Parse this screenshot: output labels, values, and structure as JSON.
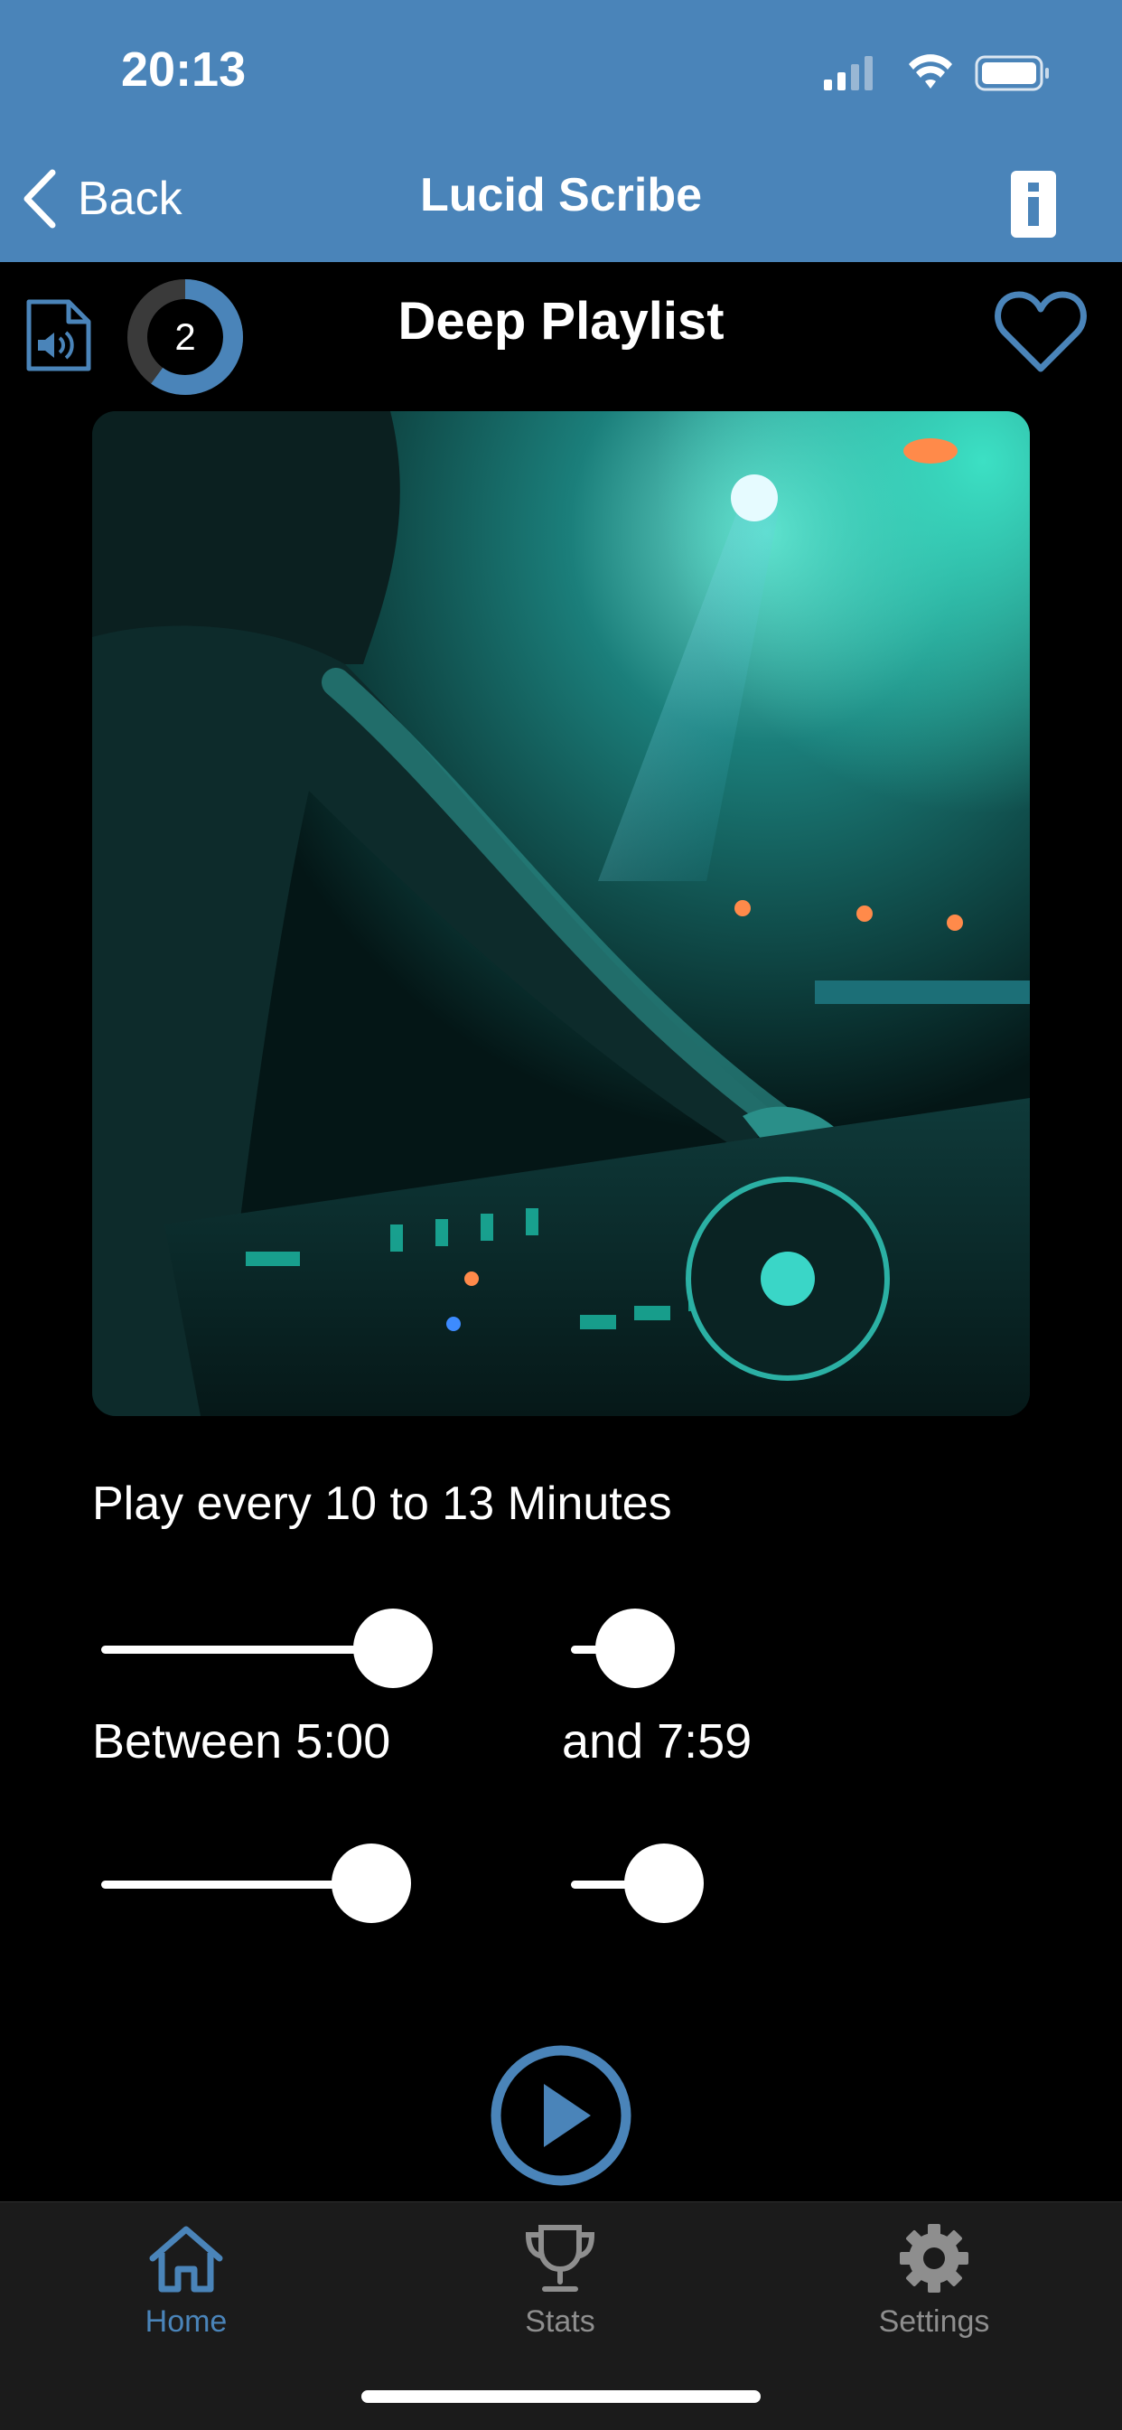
{
  "status_bar": {
    "time": "20:13"
  },
  "nav": {
    "back_label": "Back",
    "title": "Lucid Scribe"
  },
  "playlist": {
    "title": "Deep Playlist",
    "count": "2",
    "count_progress": 0.6
  },
  "settings": {
    "play_every": "Play every 10 to 13 Minutes",
    "between": "Between 5:00",
    "and": "and 7:59"
  },
  "sliders": [
    {
      "name": "interval-min",
      "value": 0.85
    },
    {
      "name": "interval-max",
      "value": 0.1
    },
    {
      "name": "window-start",
      "value": 0.78
    },
    {
      "name": "window-end",
      "value": 0.18
    }
  ],
  "tabs": [
    {
      "label": "Home",
      "icon": "home-icon",
      "active": true
    },
    {
      "label": "Stats",
      "icon": "trophy-icon",
      "active": false
    },
    {
      "label": "Settings",
      "icon": "gear-icon",
      "active": false
    }
  ],
  "colors": {
    "accent": "#4a84b9",
    "inactive": "#8e8e8e",
    "background": "#000000"
  }
}
